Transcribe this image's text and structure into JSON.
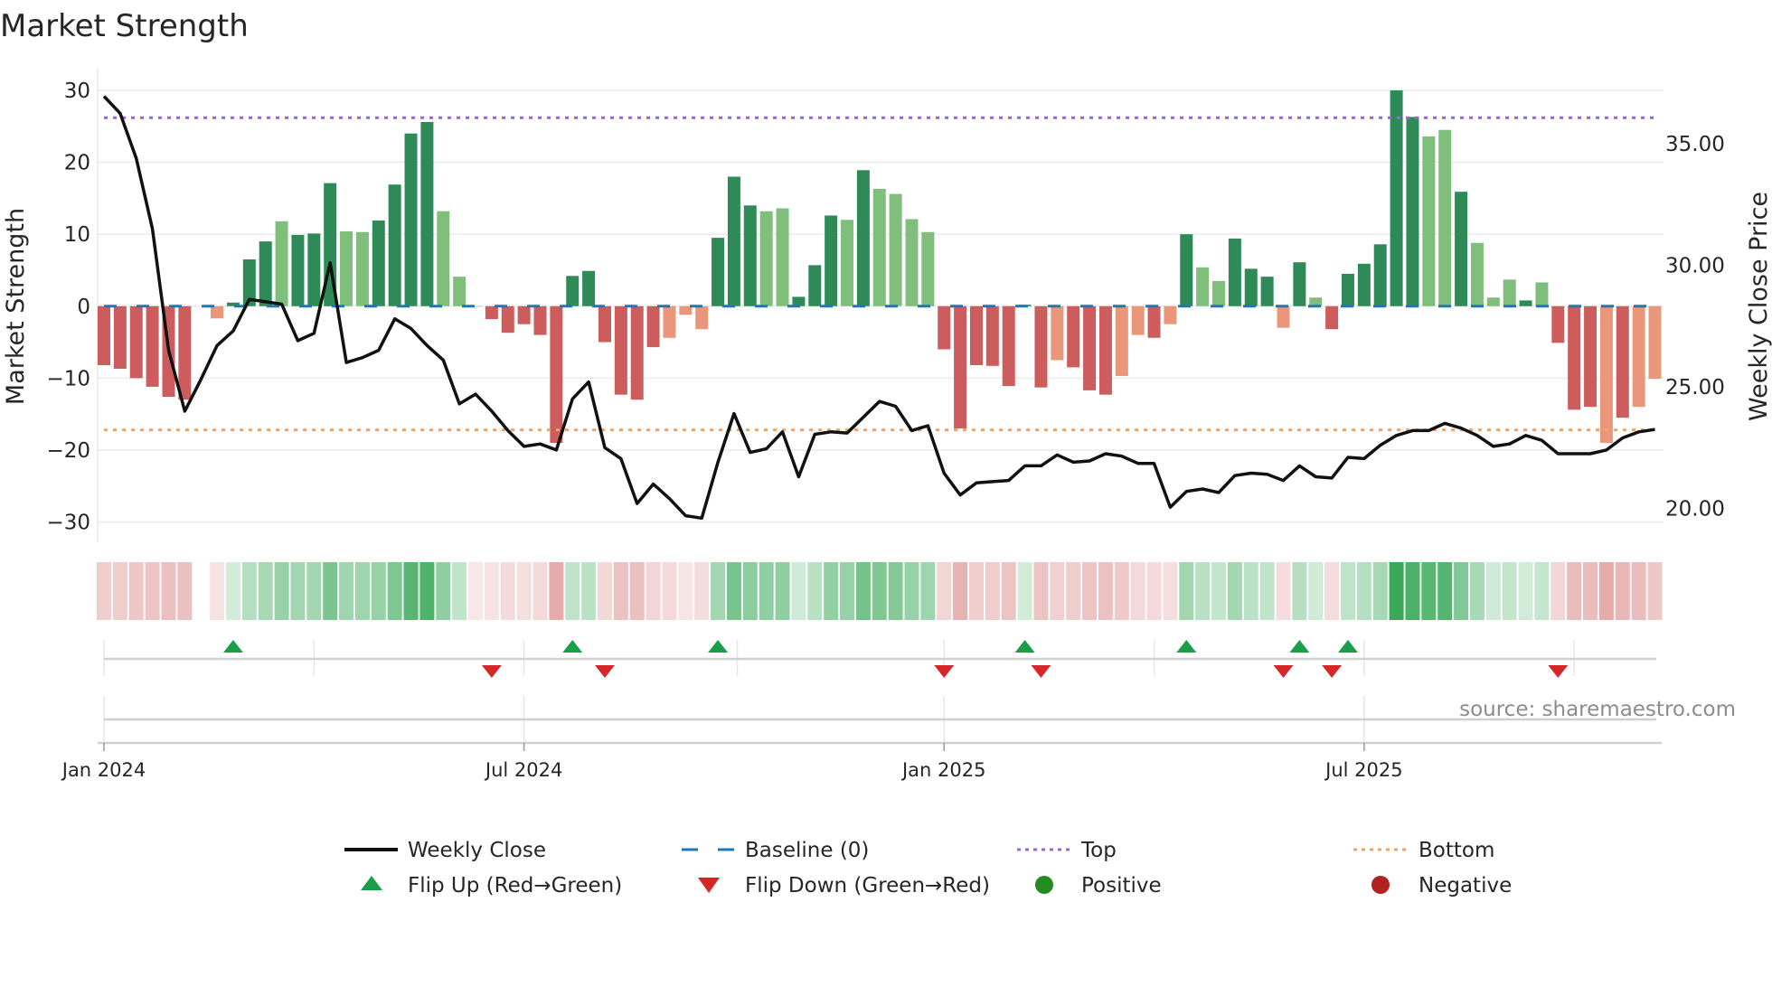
{
  "chart_data": {
    "type": "bar",
    "title": "Market Strength",
    "ylabel": "Market Strength",
    "y2label": "Weekly Close Price",
    "ylim": [
      -33,
      33
    ],
    "y2lim": [
      18.5,
      37.5
    ],
    "yticks": [
      "30",
      "20",
      "10",
      "0",
      "−10",
      "−20",
      "−30"
    ],
    "ytick_values": [
      30,
      20,
      10,
      0,
      -10,
      -20,
      -30
    ],
    "y2ticks": [
      "35.00",
      "30.00",
      "25.00",
      "20.00"
    ],
    "y2tick_values": [
      35,
      30,
      25,
      20
    ],
    "xticks": [
      "Jan 2024",
      "Jul 2024",
      "Jan 2025",
      "Jul 2025"
    ],
    "xtick_weeks": [
      0,
      26,
      52,
      78
    ],
    "quarter_weeks": [
      0,
      13,
      26,
      39.2,
      52,
      65,
      78,
      91
    ],
    "frequency": "weekly",
    "grid": true,
    "top_level": 26.2,
    "bottom_level": -17.2,
    "strength": [
      -8.2,
      -8.7,
      -10,
      -11.2,
      -12.6,
      -13,
      null,
      -1.7,
      0.5,
      6.5,
      9,
      11.8,
      9.9,
      10.1,
      17.1,
      10.4,
      10.3,
      11.9,
      16.9,
      24,
      25.6,
      13.2,
      4.1,
      0,
      -1.8,
      -3.7,
      -2.5,
      -4,
      -19,
      4.2,
      4.9,
      -5,
      -12.3,
      -13,
      -5.7,
      -4.4,
      -1.2,
      -3.2,
      9.5,
      18,
      14,
      13.2,
      13.6,
      1.3,
      5.7,
      12.6,
      12,
      18.9,
      16.3,
      15.6,
      12.1,
      10.3,
      -6,
      -17,
      -8.2,
      -8.3,
      -11.1,
      0.2,
      -11.3,
      -7.5,
      -8.5,
      -11.7,
      -12.3,
      -9.7,
      -4,
      -4.4,
      -2.5,
      10,
      5.4,
      3.5,
      9.4,
      5.2,
      4.1,
      -3,
      6.1,
      1.2,
      -3.2,
      4.5,
      5.9,
      8.6,
      30,
      26.3,
      23.6,
      24.5,
      15.9,
      8.8,
      1.2,
      3.7,
      0.8,
      3.3,
      -5.1,
      -14.4,
      -14,
      -19,
      -15.5,
      -14,
      -10.1
    ],
    "shade": "ddddddnldddldddllddddllndddddddddddllldddlldddldlllldddddddldddlldldlldddldlddddddlldllldldddldlll",
    "weekly_close": [
      36.95,
      36.25,
      34.4,
      31.5,
      26.5,
      24.0,
      25.3,
      26.7,
      27.3,
      28.6,
      28.5,
      28.4,
      26.9,
      27.2,
      30.1,
      26.0,
      26.2,
      26.5,
      27.8,
      27.4,
      26.7,
      26.1,
      24.3,
      24.7,
      24.0,
      23.2,
      22.55,
      22.65,
      22.4,
      24.5,
      25.2,
      22.5,
      22.05,
      20.2,
      21.0,
      20.4,
      19.7,
      19.6,
      21.9,
      23.9,
      22.3,
      22.45,
      23.15,
      21.3,
      23.05,
      23.15,
      23.1,
      23.75,
      24.4,
      24.2,
      23.2,
      23.4,
      21.45,
      20.55,
      21.05,
      21.1,
      21.15,
      21.75,
      21.75,
      22.2,
      21.9,
      21.95,
      22.25,
      22.15,
      21.85,
      21.85,
      20.05,
      20.7,
      20.8,
      20.65,
      21.35,
      21.45,
      21.4,
      21.15,
      21.75,
      21.3,
      21.25,
      22.1,
      22.05,
      22.6,
      23.0,
      23.2,
      23.2,
      23.5,
      23.3,
      23.0,
      22.55,
      22.65,
      23.0,
      22.8,
      22.25,
      22.25,
      22.25,
      22.4,
      22.9,
      23.15,
      23.25
    ],
    "flip_up_weeks": [
      8,
      29,
      38,
      57,
      67,
      74,
      77
    ],
    "flip_down_weeks": [
      24,
      31,
      52,
      58,
      73,
      76,
      90
    ],
    "legend": {
      "placement": "bottom",
      "items": [
        "Weekly Close",
        "Baseline (0)",
        "Top",
        "Bottom",
        "Flip Up (Red→Green)",
        "Flip Down (Green→Red)",
        "Positive",
        "Negative"
      ]
    },
    "source": "source: sharemaestro.com"
  },
  "colors": {
    "pos_strong": "#2e8b57",
    "pos_weak": "#7fbf7b",
    "neg_strong": "#cd5c5c",
    "neg_weak": "#e9967a",
    "line": "#111111",
    "baseline": "#1f77b4",
    "top": "#9467dd",
    "bottom": "#f4a460",
    "flip_up": "#1a9e4a",
    "flip_down": "#d62728",
    "positive": "#228b22",
    "negative": "#b22222"
  }
}
